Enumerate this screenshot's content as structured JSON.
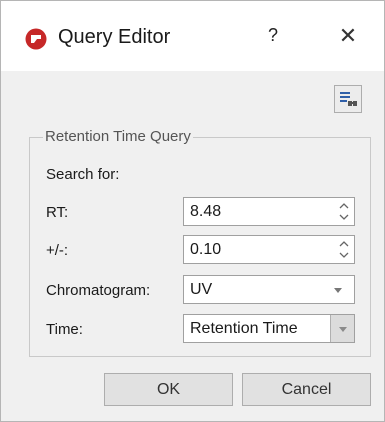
{
  "window": {
    "title": "Query Editor",
    "help_label": "?",
    "close_label": "✕"
  },
  "toolbar": {
    "icon": "find-in-list-icon"
  },
  "group": {
    "title": "Retention Time Query",
    "search_for_label": "Search for:",
    "rt": {
      "label": "RT:",
      "value": "8.48"
    },
    "tolerance": {
      "label": "+/-:",
      "value": "0.10"
    },
    "chromatogram": {
      "label": "Chromatogram:",
      "value": "UV"
    },
    "time": {
      "label": "Time:",
      "value": "Retention Time"
    }
  },
  "buttons": {
    "ok": "OK",
    "cancel": "Cancel"
  },
  "colors": {
    "app_icon": "#c62828",
    "dialog_bg": "#f0f0f0"
  }
}
